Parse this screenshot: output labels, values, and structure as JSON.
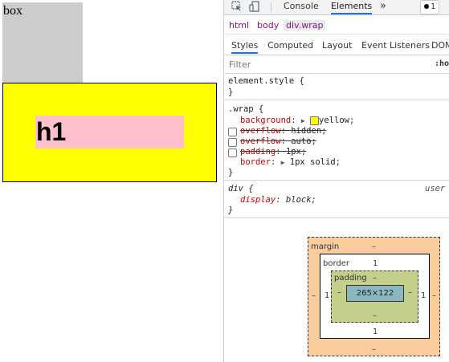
{
  "page": {
    "box_text": "box",
    "h1_text": "h1",
    "colors": {
      "box_bg": "#cccccc",
      "wrap_bg": "#ffff00",
      "h1_bg": "#ffc0cb"
    }
  },
  "devtools": {
    "toolbar": {
      "inspect_icon": "cursor-icon",
      "device_icon": "device-icon",
      "tabs": [
        "Console",
        "Elements"
      ],
      "active_tab": "Elements",
      "more": "»",
      "error_count": "1"
    },
    "breadcrumbs": [
      "html",
      "body",
      "div.wrap"
    ],
    "subtabs": [
      "Styles",
      "Computed",
      "Layout",
      "Event Listeners",
      "DOM"
    ],
    "filter": {
      "placeholder": "Filter",
      "hov": ":ho"
    },
    "element_style": {
      "selector": "element.style {",
      "close": "}"
    },
    "wrap_rule": {
      "selector": ".wrap {",
      "declarations": [
        {
          "name": "background",
          "value": "yellow",
          "enabled": true,
          "checkbox": false
        },
        {
          "name": "overflow",
          "value": "hidden",
          "enabled": false,
          "checkbox": true
        },
        {
          "name": "overflow",
          "value": "auto",
          "enabled": false,
          "checkbox": true
        },
        {
          "name": "padding",
          "value": "1px",
          "enabled": false,
          "checkbox": true
        },
        {
          "name": "border",
          "value": "1px solid",
          "enabled": true,
          "checkbox": false
        }
      ],
      "close": "}"
    },
    "ua_rule": {
      "selector": "div {",
      "origin": "user a",
      "declaration_name": "display",
      "declaration_value": "block",
      "close": "}"
    },
    "box_model": {
      "margin_label": "margin",
      "margin_top": "–",
      "margin_bottom": "–",
      "margin_left": "–",
      "margin_right": "–",
      "border_label": "border",
      "border_top": "1",
      "border_bottom": "1",
      "border_left": "1",
      "border_right": "1",
      "padding_label": "padding",
      "padding_top": "–",
      "padding_bottom": "–",
      "padding_left": "–",
      "padding_right": "–",
      "content": "265×122"
    }
  }
}
